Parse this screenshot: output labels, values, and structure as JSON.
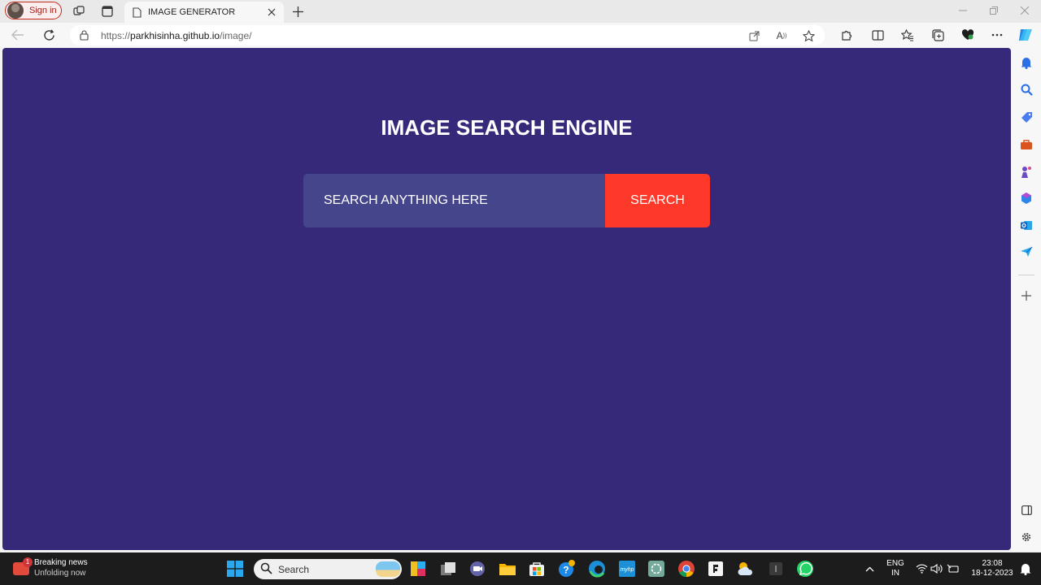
{
  "browser": {
    "signin_label": "Sign in",
    "tab_title": "IMAGE GENERATOR",
    "url_prefix": "https://",
    "url_host": "parkhisinha.github.io",
    "url_path": "/image/"
  },
  "page": {
    "heading": "IMAGE SEARCH ENGINE",
    "search_placeholder": "SEARCH ANYTHING HERE",
    "search_button": "SEARCH",
    "colors": {
      "background": "#37297a",
      "input": "#44458a",
      "button": "#ff3929"
    }
  },
  "taskbar": {
    "news_badge": "1",
    "news_title": "Breaking news",
    "news_subtitle": "Unfolding now",
    "search_label": "Search",
    "lang_line1": "ENG",
    "lang_line2": "IN",
    "time": "23:08",
    "date": "18-12-2023"
  }
}
